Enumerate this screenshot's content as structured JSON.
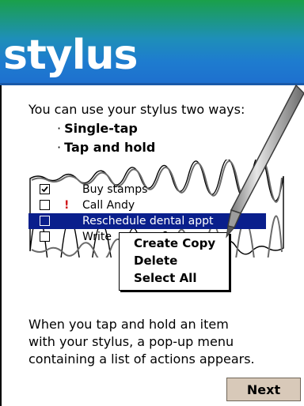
{
  "header": {
    "title": "stylus"
  },
  "intro": {
    "line": "You can use your stylus two ways:",
    "bullets": [
      "Single-tap",
      "Tap and hold"
    ],
    "bullet_symbol": "·"
  },
  "task_list": {
    "items": [
      {
        "label": "Buy stamps",
        "checked": true,
        "priority": "",
        "selected": false
      },
      {
        "label": "Call Andy",
        "checked": false,
        "priority": "!",
        "selected": false
      },
      {
        "label": "Reschedule dental appt",
        "checked": false,
        "priority": "",
        "selected": true
      },
      {
        "label": "Write",
        "checked": false,
        "priority": "",
        "selected": false
      }
    ]
  },
  "context_menu": {
    "items": [
      "Create Copy",
      "Delete",
      "Select All"
    ]
  },
  "description": {
    "lines": [
      "When you tap and hold an item",
      "with your stylus, a pop-up menu",
      "containing a list of actions appears."
    ]
  },
  "next_label": "Next",
  "colors": {
    "header_top": "#1aa04a",
    "header_bottom": "#1e6fcf",
    "selection": "#0a1f8c",
    "priority": "#d0181b",
    "button_face": "#d8c9b9"
  },
  "icons": {
    "checkmark": "checkmark-icon",
    "priority": "exclamation-icon",
    "stylus": "stylus-pen-icon"
  }
}
